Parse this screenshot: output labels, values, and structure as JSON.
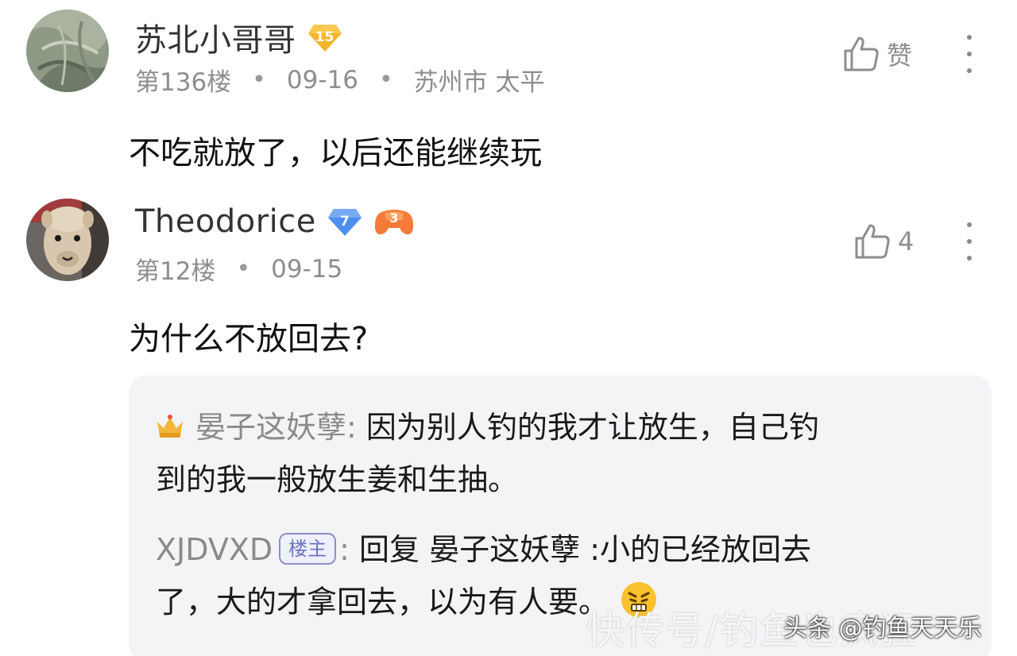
{
  "comments": [
    {
      "username": "苏北小哥哥",
      "level": "15",
      "floor": "第136楼",
      "date": "09-16",
      "location": "苏州市 太平",
      "like_label": "赞",
      "text": "不吃就放了，以后还能继续玩",
      "avatar_icon": "leaf-avatar-icon",
      "badge_color": "#f3b52b"
    },
    {
      "username": "Theodorice",
      "level": "7",
      "game_level": "3",
      "floor": "第12楼",
      "date": "09-15",
      "like_count": "4",
      "text": "为什么不放回去?",
      "avatar_icon": "alpaca-avatar-icon",
      "badge_color": "#4c8ff0",
      "game_badge_color": "#f47b3a",
      "replies": [
        {
          "author": "晏子这妖孽",
          "separator": ":",
          "text_line1": "因为别人钓的我才让放生，自己钓",
          "text_line2": "到的我一般放生姜和生抽。",
          "icon": "crown-icon"
        },
        {
          "author": "XJDVXD",
          "tag": "楼主",
          "separator": ":",
          "text_line1": "回复 晏子这妖孽 :小的已经放回去",
          "text_line2": "了，大的才拿回去，以为有人要。",
          "icon": "frustrated-face-emoji-icon"
        }
      ]
    }
  ],
  "watermark": {
    "main": "快传号/钓鱼也疯狂",
    "platform": "头条 @钓鱼天天乐"
  }
}
